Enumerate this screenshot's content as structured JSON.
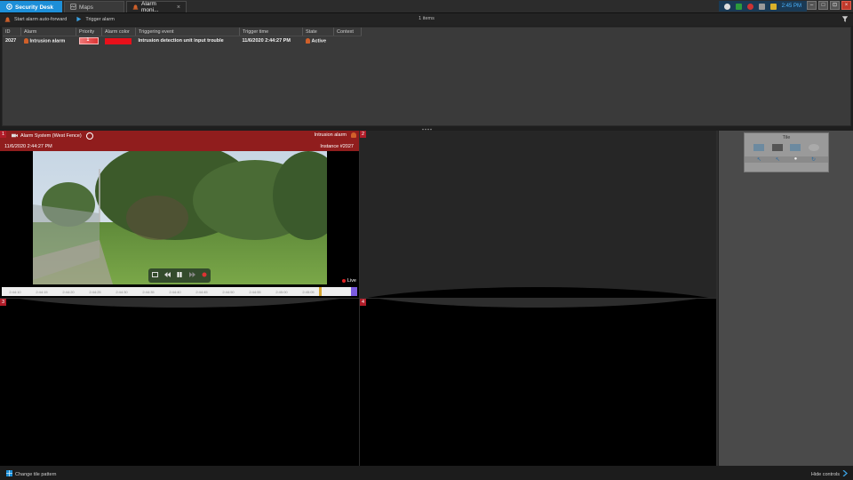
{
  "tabs": [
    {
      "label": "Security Desk",
      "icon": "security-desk-icon"
    },
    {
      "label": "Maps",
      "icon": "maps-icon"
    },
    {
      "label": "Alarm moni...",
      "icon": "alarm-icon"
    }
  ],
  "tray": {
    "time": "2:45 PM"
  },
  "toolbar": {
    "auto_forward_label": "Start alarm auto-forward",
    "trigger_label": "Trigger alarm",
    "items_count": "1 items"
  },
  "alarm_table": {
    "columns": [
      "ID",
      "Alarm",
      "Priority",
      "Alarm color",
      "Triggering event",
      "Trigger time",
      "State",
      "Context"
    ],
    "rows": [
      {
        "id": "2027",
        "alarm": "Intrusion alarm",
        "priority": "1",
        "alarm_color": "#e8101a",
        "triggering_event": "Intrusion detection unit input trouble",
        "trigger_time": "11/6/2020 2:44:27 PM",
        "state": "Active",
        "context": ""
      }
    ]
  },
  "tiles": [
    {
      "number": "1",
      "camera": "Alarm System (West Fence)",
      "alarm_name": "Intrusion alarm",
      "timestamp": "11/6/2020 2:44:27 PM",
      "instance": "Instance #2027",
      "live_label": "Live",
      "timeline_ticks": [
        "2:44:10",
        "2:44:15",
        "2:44:20",
        "2:44:25",
        "2:44:30",
        "2:44:35",
        "2:44:40",
        "2:44:45",
        "2:44:50",
        "2:44:55",
        "2:45:00",
        "2:45:05"
      ]
    },
    {
      "number": "2"
    },
    {
      "number": "3"
    },
    {
      "number": "4"
    }
  ],
  "side_panel": {
    "widget_title": "Tile"
  },
  "statusbar": {
    "change_tile_pattern": "Change tile pattern",
    "hide_controls": "Hide controls"
  },
  "colors": {
    "accent": "#1d8fd8",
    "alarm_red": "#b01c28",
    "live_red": "#e02020"
  }
}
